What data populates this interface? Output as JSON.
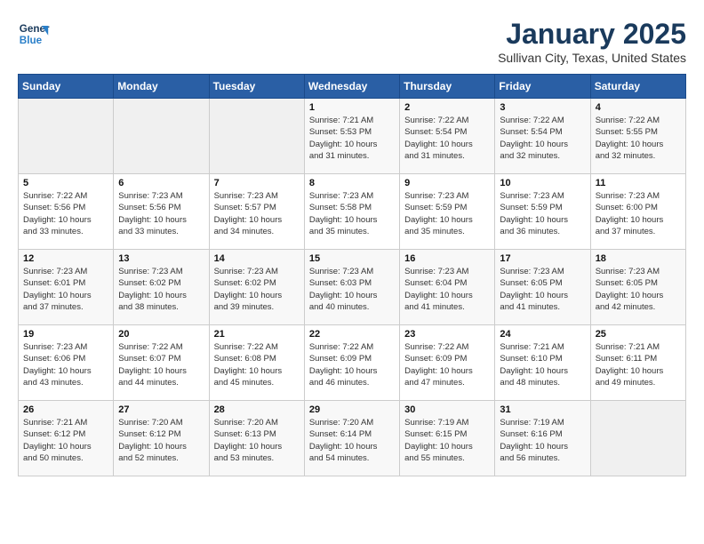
{
  "header": {
    "logo_line1": "General",
    "logo_line2": "Blue",
    "month": "January 2025",
    "location": "Sullivan City, Texas, United States"
  },
  "days_of_week": [
    "Sunday",
    "Monday",
    "Tuesday",
    "Wednesday",
    "Thursday",
    "Friday",
    "Saturday"
  ],
  "weeks": [
    [
      {
        "day": "",
        "info": ""
      },
      {
        "day": "",
        "info": ""
      },
      {
        "day": "",
        "info": ""
      },
      {
        "day": "1",
        "info": "Sunrise: 7:21 AM\nSunset: 5:53 PM\nDaylight: 10 hours\nand 31 minutes."
      },
      {
        "day": "2",
        "info": "Sunrise: 7:22 AM\nSunset: 5:54 PM\nDaylight: 10 hours\nand 31 minutes."
      },
      {
        "day": "3",
        "info": "Sunrise: 7:22 AM\nSunset: 5:54 PM\nDaylight: 10 hours\nand 32 minutes."
      },
      {
        "day": "4",
        "info": "Sunrise: 7:22 AM\nSunset: 5:55 PM\nDaylight: 10 hours\nand 32 minutes."
      }
    ],
    [
      {
        "day": "5",
        "info": "Sunrise: 7:22 AM\nSunset: 5:56 PM\nDaylight: 10 hours\nand 33 minutes."
      },
      {
        "day": "6",
        "info": "Sunrise: 7:23 AM\nSunset: 5:56 PM\nDaylight: 10 hours\nand 33 minutes."
      },
      {
        "day": "7",
        "info": "Sunrise: 7:23 AM\nSunset: 5:57 PM\nDaylight: 10 hours\nand 34 minutes."
      },
      {
        "day": "8",
        "info": "Sunrise: 7:23 AM\nSunset: 5:58 PM\nDaylight: 10 hours\nand 35 minutes."
      },
      {
        "day": "9",
        "info": "Sunrise: 7:23 AM\nSunset: 5:59 PM\nDaylight: 10 hours\nand 35 minutes."
      },
      {
        "day": "10",
        "info": "Sunrise: 7:23 AM\nSunset: 5:59 PM\nDaylight: 10 hours\nand 36 minutes."
      },
      {
        "day": "11",
        "info": "Sunrise: 7:23 AM\nSunset: 6:00 PM\nDaylight: 10 hours\nand 37 minutes."
      }
    ],
    [
      {
        "day": "12",
        "info": "Sunrise: 7:23 AM\nSunset: 6:01 PM\nDaylight: 10 hours\nand 37 minutes."
      },
      {
        "day": "13",
        "info": "Sunrise: 7:23 AM\nSunset: 6:02 PM\nDaylight: 10 hours\nand 38 minutes."
      },
      {
        "day": "14",
        "info": "Sunrise: 7:23 AM\nSunset: 6:02 PM\nDaylight: 10 hours\nand 39 minutes."
      },
      {
        "day": "15",
        "info": "Sunrise: 7:23 AM\nSunset: 6:03 PM\nDaylight: 10 hours\nand 40 minutes."
      },
      {
        "day": "16",
        "info": "Sunrise: 7:23 AM\nSunset: 6:04 PM\nDaylight: 10 hours\nand 41 minutes."
      },
      {
        "day": "17",
        "info": "Sunrise: 7:23 AM\nSunset: 6:05 PM\nDaylight: 10 hours\nand 41 minutes."
      },
      {
        "day": "18",
        "info": "Sunrise: 7:23 AM\nSunset: 6:05 PM\nDaylight: 10 hours\nand 42 minutes."
      }
    ],
    [
      {
        "day": "19",
        "info": "Sunrise: 7:23 AM\nSunset: 6:06 PM\nDaylight: 10 hours\nand 43 minutes."
      },
      {
        "day": "20",
        "info": "Sunrise: 7:22 AM\nSunset: 6:07 PM\nDaylight: 10 hours\nand 44 minutes."
      },
      {
        "day": "21",
        "info": "Sunrise: 7:22 AM\nSunset: 6:08 PM\nDaylight: 10 hours\nand 45 minutes."
      },
      {
        "day": "22",
        "info": "Sunrise: 7:22 AM\nSunset: 6:09 PM\nDaylight: 10 hours\nand 46 minutes."
      },
      {
        "day": "23",
        "info": "Sunrise: 7:22 AM\nSunset: 6:09 PM\nDaylight: 10 hours\nand 47 minutes."
      },
      {
        "day": "24",
        "info": "Sunrise: 7:21 AM\nSunset: 6:10 PM\nDaylight: 10 hours\nand 48 minutes."
      },
      {
        "day": "25",
        "info": "Sunrise: 7:21 AM\nSunset: 6:11 PM\nDaylight: 10 hours\nand 49 minutes."
      }
    ],
    [
      {
        "day": "26",
        "info": "Sunrise: 7:21 AM\nSunset: 6:12 PM\nDaylight: 10 hours\nand 50 minutes."
      },
      {
        "day": "27",
        "info": "Sunrise: 7:20 AM\nSunset: 6:12 PM\nDaylight: 10 hours\nand 52 minutes."
      },
      {
        "day": "28",
        "info": "Sunrise: 7:20 AM\nSunset: 6:13 PM\nDaylight: 10 hours\nand 53 minutes."
      },
      {
        "day": "29",
        "info": "Sunrise: 7:20 AM\nSunset: 6:14 PM\nDaylight: 10 hours\nand 54 minutes."
      },
      {
        "day": "30",
        "info": "Sunrise: 7:19 AM\nSunset: 6:15 PM\nDaylight: 10 hours\nand 55 minutes."
      },
      {
        "day": "31",
        "info": "Sunrise: 7:19 AM\nSunset: 6:16 PM\nDaylight: 10 hours\nand 56 minutes."
      },
      {
        "day": "",
        "info": ""
      }
    ]
  ]
}
